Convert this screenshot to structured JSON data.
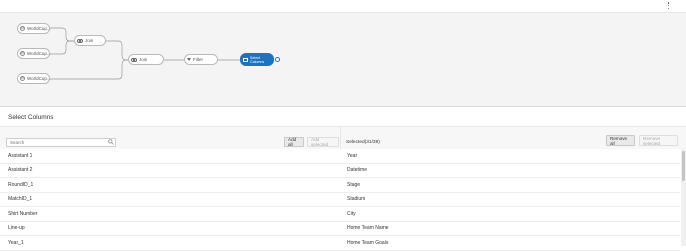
{
  "pipeline": {
    "sources": [
      "WorldCup...",
      "WorldCup...",
      "WorldCup..."
    ],
    "join1": "Join",
    "join2": "Join",
    "filter": "Filter",
    "select_line1": "Select",
    "select_line2": "Columns"
  },
  "panel": {
    "title": "Select Columns"
  },
  "toolbar": {
    "search_placeholder": "Search",
    "add_all": "Add all",
    "add_selected": "Add selected",
    "selected_label": "Selected(31/39)",
    "remove_all": "Remove all",
    "remove_selected": "Remove selected"
  },
  "available_columns": [
    "Assistant 1",
    "Assistant 2",
    "RoundID_1",
    "MatchID_1",
    "Shirt Number",
    "Line-up",
    "Year_1"
  ],
  "selected_columns": [
    "Year",
    "Datetime",
    "Stage",
    "Stadium",
    "City",
    "Home Team Name",
    "Home Team Goals"
  ],
  "colors": {
    "accent": "#1e73be"
  }
}
